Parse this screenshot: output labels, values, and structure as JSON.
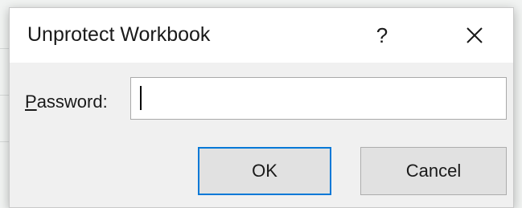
{
  "dialog": {
    "title": "Unprotect Workbook",
    "help_label": "?",
    "password_label_accesskey": "P",
    "password_label_rest": "assword:",
    "password_value": "",
    "ok_label": "OK",
    "cancel_label": "Cancel"
  },
  "icons": {
    "close": "close-icon",
    "help": "help-icon"
  },
  "colors": {
    "dialog_bg": "#f0f0f0",
    "titlebar_bg": "#ffffff",
    "default_button_border": "#0078d7",
    "button_bg": "#e1e1e1"
  }
}
